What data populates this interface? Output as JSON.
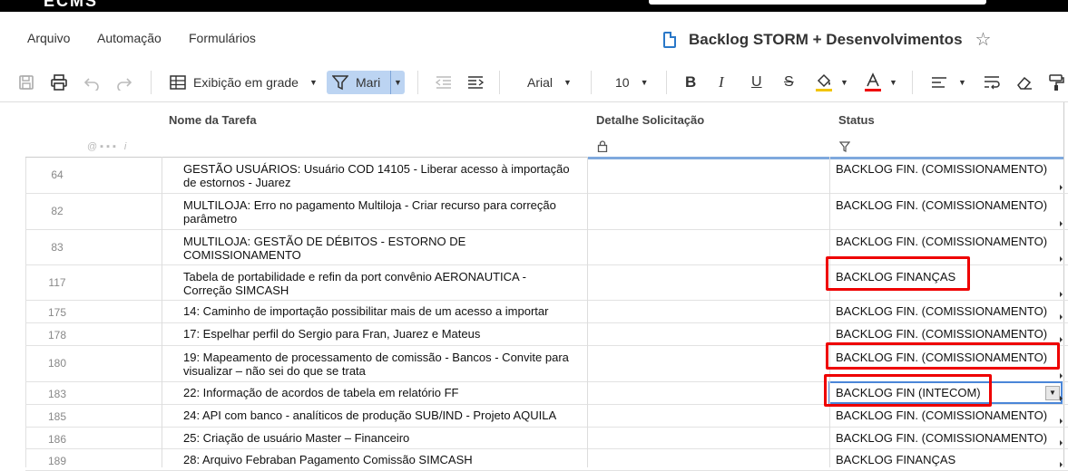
{
  "app": {
    "logo": "ECMS"
  },
  "menu": {
    "items": [
      "Arquivo",
      "Automação",
      "Formulários"
    ]
  },
  "document": {
    "title": "Backlog STORM + Desenvolvimentos"
  },
  "toolbar": {
    "view_label": "Exibição em grade",
    "filter_label": "Mari",
    "font_label": "Arial",
    "font_size_label": "10"
  },
  "colors": {
    "accent": "#2a78c8",
    "filter_bg": "#bcd4f2",
    "highlight": "#e00000"
  },
  "grid": {
    "columns": [
      "Nome da Tarefa",
      "Detalhe Solicitação",
      "Status"
    ],
    "rows": [
      {
        "num": "64",
        "task": [
          "GESTÃO USUÁRIOS: Usuário COD 14105 - Liberar acesso à importação",
          "de estornos - Juarez"
        ],
        "status": "BACKLOG FIN. (COMISSIONAMENTO)"
      },
      {
        "num": "82",
        "task": [
          "MULTILOJA: Erro no pagamento Multiloja - Criar recurso para correção",
          "parâmetro"
        ],
        "status": "BACKLOG FIN. (COMISSIONAMENTO)"
      },
      {
        "num": "83",
        "task": [
          "MULTILOJA: GESTÃO DE DÉBITOS - ESTORNO DE",
          "COMISSIONAMENTO"
        ],
        "status": "BACKLOG FIN. (COMISSIONAMENTO)"
      },
      {
        "num": "117",
        "task": [
          "Tabela de portabilidade e refin da port convênio AERONAUTICA -",
          "Correção SIMCASH"
        ],
        "status": "BACKLOG FINANÇAS"
      },
      {
        "num": "175",
        "task": [
          "14: Caminho de importação possibilitar mais de um acesso a importar"
        ],
        "status": "BACKLOG FIN. (COMISSIONAMENTO)"
      },
      {
        "num": "178",
        "task": [
          "17: Espelhar perfil do Sergio para Fran, Juarez e Mateus"
        ],
        "status": "BACKLOG FIN. (COMISSIONAMENTO)"
      },
      {
        "num": "180",
        "task": [
          "19: Mapeamento de processamento de comissão - Bancos - Convite para",
          "visualizar – não sei do que se trata"
        ],
        "status": "BACKLOG FIN. (COMISSIONAMENTO)"
      },
      {
        "num": "183",
        "task": [
          "22: Informação de acordos de tabela em relatório FF"
        ],
        "status": "BACKLOG FIN (INTECOM)"
      },
      {
        "num": "185",
        "task": [
          "24: API com banco - analíticos de produção SUB/IND - Projeto AQUILA"
        ],
        "status": "BACKLOG FIN. (COMISSIONAMENTO)"
      },
      {
        "num": "186",
        "task": [
          "25: Criação de usuário Master – Financeiro"
        ],
        "status": "BACKLOG FIN. (COMISSIONAMENTO)"
      },
      {
        "num": "189",
        "task": [
          "28: Arquivo Febraban Pagamento Comissão SIMCASH"
        ],
        "status": "BACKLOG FINANÇAS"
      }
    ]
  }
}
